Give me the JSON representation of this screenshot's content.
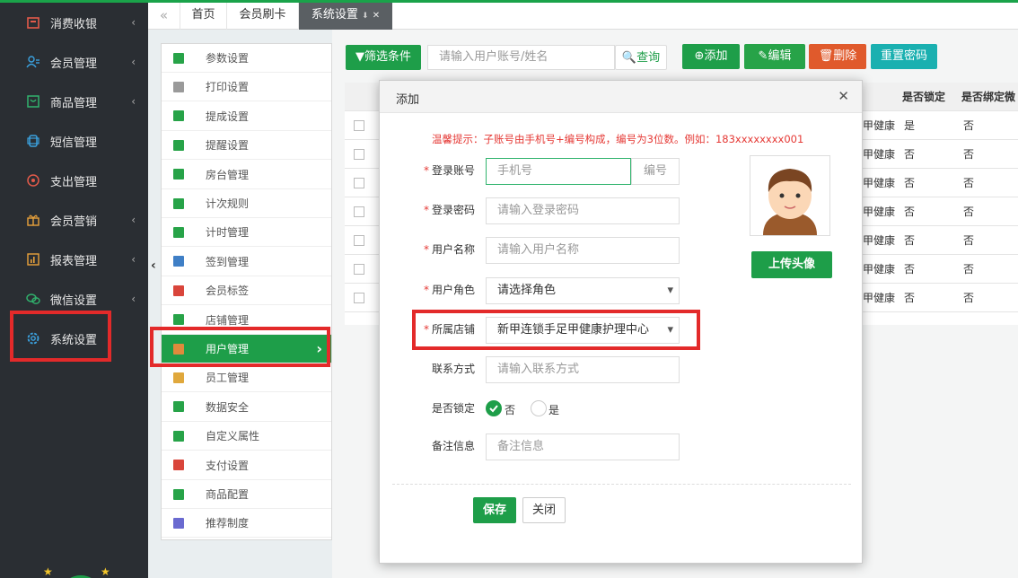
{
  "sidebar": {
    "items": [
      {
        "label": "消费收银",
        "icon": "cashier-icon",
        "arrow": "‹"
      },
      {
        "label": "会员管理",
        "icon": "members-icon",
        "arrow": "‹"
      },
      {
        "label": "商品管理",
        "icon": "goods-icon",
        "arrow": "‹"
      },
      {
        "label": "短信管理",
        "icon": "sms-icon",
        "arrow": ""
      },
      {
        "label": "支出管理",
        "icon": "expense-icon",
        "arrow": ""
      },
      {
        "label": "会员营销",
        "icon": "gift-icon",
        "arrow": "‹"
      },
      {
        "label": "报表管理",
        "icon": "report-icon",
        "arrow": "‹"
      },
      {
        "label": "微信设置",
        "icon": "wechat-icon",
        "arrow": "‹"
      },
      {
        "label": "系统设置",
        "icon": "settings-gear-icon",
        "arrow": ""
      }
    ]
  },
  "tabs": {
    "nav_back": "«",
    "items": [
      {
        "label": "首页"
      },
      {
        "label": "会员刷卡"
      },
      {
        "label": "系统设置"
      }
    ],
    "pin": "⬇",
    "close": "✕"
  },
  "submenu": {
    "collapse": "‹",
    "items": [
      {
        "label": "参数设置",
        "color": "#27a348"
      },
      {
        "label": "打印设置",
        "color": "#9a9a9a"
      },
      {
        "label": "提成设置",
        "color": "#27a348"
      },
      {
        "label": "提醒设置",
        "color": "#27a348"
      },
      {
        "label": "房台管理",
        "color": "#27a348"
      },
      {
        "label": "计次规则",
        "color": "#27a348"
      },
      {
        "label": "计时管理",
        "color": "#27a348"
      },
      {
        "label": "签到管理",
        "color": "#3f7fc6"
      },
      {
        "label": "会员标签",
        "color": "#d9453b"
      },
      {
        "label": "店铺管理",
        "color": "#27a348"
      },
      {
        "label": "用户管理",
        "color": "#e08a3c"
      },
      {
        "label": "员工管理",
        "color": "#e0a83c"
      },
      {
        "label": "数据安全",
        "color": "#27a348"
      },
      {
        "label": "自定义属性",
        "color": "#27a348"
      },
      {
        "label": "支付设置",
        "color": "#d9453b"
      },
      {
        "label": "商品配置",
        "color": "#27a348"
      },
      {
        "label": "推荐制度",
        "color": "#6a6ad0"
      }
    ],
    "active_arrow": "›"
  },
  "toolbar": {
    "filter_label": "▼筛选条件",
    "search_placeholder": "请输入用户账号/姓名",
    "query_label": "🔍查询",
    "add_label": "⊕添加",
    "edit_label": "✎编辑",
    "delete_label": "🗑删除",
    "reset_label": "重置密码"
  },
  "table": {
    "headers": [
      "是否锁定",
      "是否绑定微"
    ],
    "rows": [
      {
        "store": "甲健康",
        "locked": "是",
        "bound": "否"
      },
      {
        "store": "甲健康",
        "locked": "否",
        "bound": "否"
      },
      {
        "store": "甲健康",
        "locked": "否",
        "bound": "否"
      },
      {
        "store": "甲健康",
        "locked": "否",
        "bound": "否"
      },
      {
        "store": "甲健康",
        "locked": "否",
        "bound": "否"
      },
      {
        "store": "甲健康",
        "locked": "否",
        "bound": "否"
      },
      {
        "store": "甲健康",
        "locked": "否",
        "bound": "否"
      }
    ]
  },
  "modal": {
    "title": "添加",
    "close": "✕",
    "hint": "温馨提示：子账号由手机号+编号构成，编号为3位数。例如：183xxxxxxxx001",
    "fields": {
      "account_label": "登录账号",
      "account_placeholder": "手机号",
      "account_suffix": "编号",
      "password_label": "登录密码",
      "password_placeholder": "请输入登录密码",
      "name_label": "用户名称",
      "name_placeholder": "请输入用户名称",
      "role_label": "用户角色",
      "role_value": "请选择角色",
      "store_label": "所属店铺",
      "store_value": "新甲连锁手足甲健康护理中心",
      "contact_label": "联系方式",
      "contact_placeholder": "请输入联系方式",
      "lock_label": "是否锁定",
      "lock_no": "否",
      "lock_yes": "是",
      "remark_label": "备注信息",
      "remark_placeholder": "备注信息"
    },
    "required_mark": "*",
    "select_caret": "▾",
    "upload_label": "上传头像",
    "save_label": "保存",
    "cancel_label": "关闭"
  },
  "colors": {
    "accent": "#1e9e49",
    "sidebar_bg": "#2a2e33",
    "highlight_red": "#e32a2a",
    "edit_green": "#27a348",
    "delete_orange": "#e05a2c",
    "reset_teal": "#1ab0b0"
  }
}
